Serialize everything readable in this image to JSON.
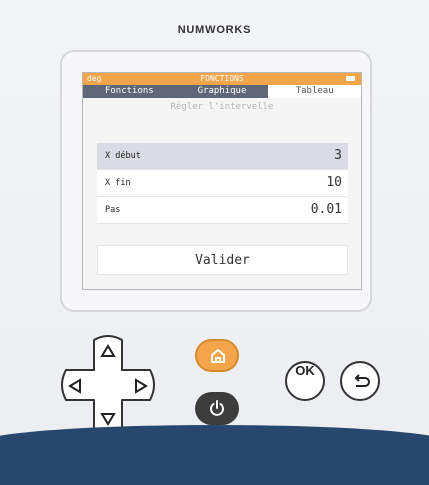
{
  "device": {
    "brand": "NUMWORKS",
    "colors": {
      "accent": "#f2a54a",
      "tab_bar": "#5f6776",
      "selected_row": "#dadbe4",
      "footer": "#27476d"
    }
  },
  "status_bar": {
    "angle_mode": "deg",
    "app_title": "FONCTIONS",
    "battery_icon": "battery-icon"
  },
  "tabs": [
    {
      "label": "Fonctions",
      "active": false
    },
    {
      "label": "Graphique",
      "active": false
    },
    {
      "label": "Tableau",
      "active": true
    }
  ],
  "interval_header": "Régler l'intervelle",
  "parameters": [
    {
      "label": "X début",
      "value": "3",
      "selected": true
    },
    {
      "label": "X fin",
      "value": "10",
      "selected": false
    },
    {
      "label": "Pas",
      "value": "0.01",
      "selected": false
    }
  ],
  "validate_label": "Valider",
  "keys": {
    "ok_label": "OK",
    "home_icon": "home-icon",
    "power_icon": "power-icon",
    "back_icon": "back-icon",
    "dpad": [
      "arrow-up-icon",
      "arrow-left-icon",
      "arrow-right-icon",
      "arrow-down-icon"
    ]
  }
}
